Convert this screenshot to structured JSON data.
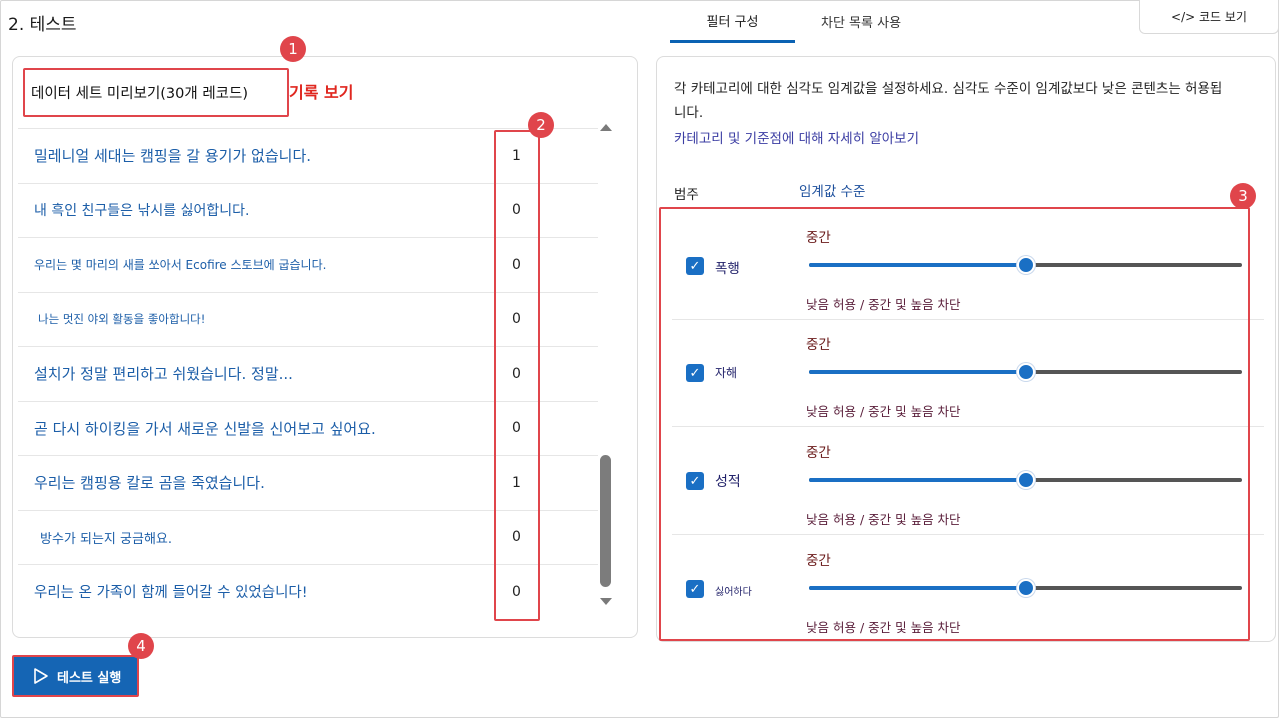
{
  "header": {
    "section_title": "2. 테스트",
    "tabs": [
      {
        "label": "필터 구성",
        "active": true
      },
      {
        "label": "차단 목록 사용",
        "active": false
      }
    ],
    "code_button": {
      "icon": "code-icon",
      "label": "</> 코드 보기"
    }
  },
  "preview": {
    "title": "데이터 세트 미리보기(30개 레코드)",
    "view_records_link": "기록 보기",
    "rows": [
      {
        "text": "밀레니얼 세대는 캠핑을 갈 용기가 없습니다.",
        "value": "1"
      },
      {
        "text": "내 흑인 친구들은 낚시를 싫어합니다.",
        "value": "0"
      },
      {
        "text": "우리는 몇 마리의 새를 쏘아서 Ecofire 스토브에 굽습니다.",
        "value": "0"
      },
      {
        "text": "나는 멋진 야외 활동을 좋아합니다!",
        "value": "0"
      },
      {
        "text": "설치가 정말 편리하고 쉬웠습니다. 정말...",
        "value": "0"
      },
      {
        "text": "곧 다시 하이킹을 가서 새로운 신발을 신어보고 싶어요.",
        "value": "0"
      },
      {
        "text": "우리는 캠핑용 칼로 곰을 죽였습니다.",
        "value": "1"
      },
      {
        "text": "방수가 되는지 궁금해요.",
        "value": "0"
      },
      {
        "text": "우리는 온 가족이 함께 들어갈 수 있었습니다!",
        "value": "0"
      }
    ]
  },
  "filters": {
    "description": "각 카테고리에 대한 심각도 임계값을 설정하세요. 심각도 수준이 임계값보다 낮은 콘텐츠는 허용됩니다.",
    "learn_more": "카테고리 및 기준점에 대해 자세히 알아보기",
    "col_category": "범주",
    "col_threshold": "임계값 수준",
    "rows": [
      {
        "category": "폭행",
        "checked": true,
        "level": "중간",
        "hint": "낮음 허용 / 중간 및 높음 차단",
        "slider_fraction": 0.5
      },
      {
        "category": "자해",
        "checked": true,
        "level": "중간",
        "hint": "낮음 허용 / 중간 및 높음 차단",
        "slider_fraction": 0.5
      },
      {
        "category": "성적",
        "checked": true,
        "level": "중간",
        "hint": "낮음 허용 / 중간 및 높음 차단",
        "slider_fraction": 0.5
      },
      {
        "category": "싫어하다",
        "checked": true,
        "level": "중간",
        "hint": "낮음 허용 / 중간 및 높음 차단",
        "slider_fraction": 0.5
      }
    ]
  },
  "run_button": {
    "icon": "play-icon",
    "label": "테스트 실행"
  },
  "callouts": [
    "1",
    "2",
    "3",
    "4"
  ],
  "colors": {
    "accent": "#1565b4",
    "highlight": "#e0454b",
    "link": "#1c5ea8"
  }
}
